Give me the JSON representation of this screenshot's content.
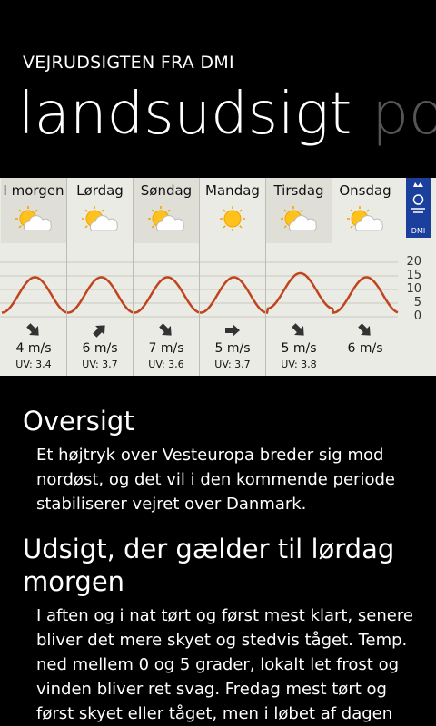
{
  "header": {
    "app_title": "VEJRUDSIGTEN FRA DMI",
    "pivot_active": "landsudsigt",
    "pivot_next": "po"
  },
  "forecast": {
    "logo_text": "DMI",
    "scale_labels": [
      "20",
      "15",
      "10",
      "5",
      "0"
    ],
    "days": [
      {
        "name": "I morgen",
        "icon": "partly-cloudy-icon",
        "wind": "4 m/s",
        "uv": "UV: 3,4",
        "arrow": "arrow-down-right-icon"
      },
      {
        "name": "Lørdag",
        "icon": "partly-cloudy-icon",
        "wind": "6 m/s",
        "uv": "UV: 3,7",
        "arrow": "arrow-up-right-icon"
      },
      {
        "name": "Søndag",
        "icon": "partly-cloudy-icon",
        "wind": "7 m/s",
        "uv": "UV: 3,6",
        "arrow": "arrow-down-right-icon"
      },
      {
        "name": "Mandag",
        "icon": "sun-icon",
        "wind": "5 m/s",
        "uv": "UV: 3,7",
        "arrow": "arrow-right-icon"
      },
      {
        "name": "Tirsdag",
        "icon": "partly-cloudy-icon",
        "wind": "5 m/s",
        "uv": "UV: 3,8",
        "arrow": "arrow-down-right-icon"
      },
      {
        "name": "Onsdag",
        "icon": "partly-cloudy-icon",
        "wind": "6 m/s",
        "uv": "",
        "arrow": "arrow-down-right-icon"
      }
    ],
    "curve_color": "#c0441d"
  },
  "sections": {
    "overview_title": "Oversigt",
    "overview_text": "Et højtryk over Vesteuropa breder sig mod nordøst, og det vil i den kommende periode stabiliserer vejret over Danmark.",
    "outlook_title": "Udsigt, der gælder til lørdag morgen",
    "outlook_text": "I aften og i nat tørt og først mest klart, senere bliver det mere skyet og stedvis tåget. Temp. ned mellem 0 og 5 grader, lokalt let frost og vinden bliver ret svag. Fredag mest tørt og først skyet eller tåget, men i løbet af dagen"
  }
}
